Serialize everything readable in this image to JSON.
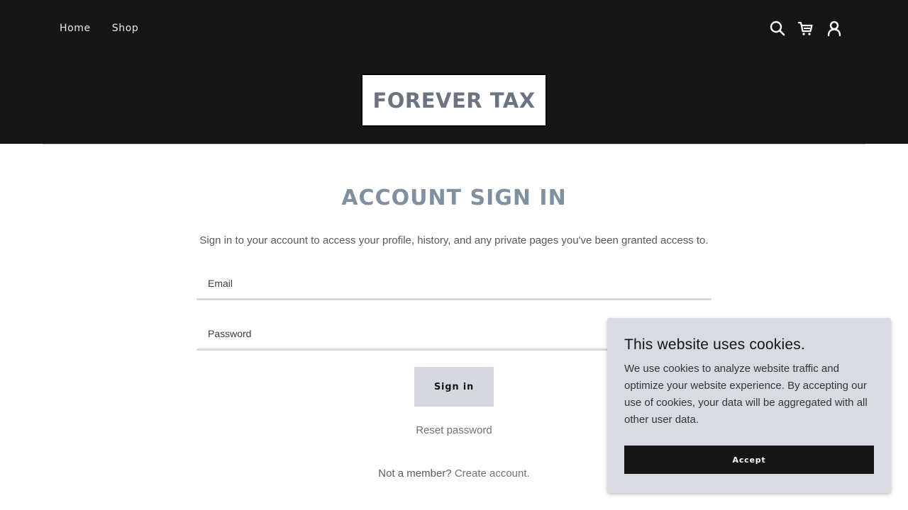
{
  "nav": {
    "home": "Home",
    "shop": "Shop"
  },
  "header_icons": [
    "search-icon",
    "cart-icon",
    "account-icon"
  ],
  "logo": {
    "text": "FOREVER TAX"
  },
  "main": {
    "title": "ACCOUNT SIGN IN",
    "subtitle": "Sign in to your account to access your profile, history, and any private pages you've been granted access to.",
    "email_placeholder": "Email",
    "password_placeholder": "Password",
    "signin_label": "Sign in",
    "reset_label": "Reset password",
    "member_prefix": "Not a member?",
    "create_account_label": "Create account."
  },
  "cookie_banner": {
    "title": "This website uses cookies.",
    "body": "We use cookies to analyze website traffic and optimize your website experience. By accepting our use of cookies, your data will be aggregated with all other user data.",
    "accept_label": "Accept"
  },
  "colors": {
    "header_bg": "#161616",
    "title": "#8190a0",
    "button_bg": "#d5d9df",
    "cookie_bg": "#d8dce2"
  }
}
